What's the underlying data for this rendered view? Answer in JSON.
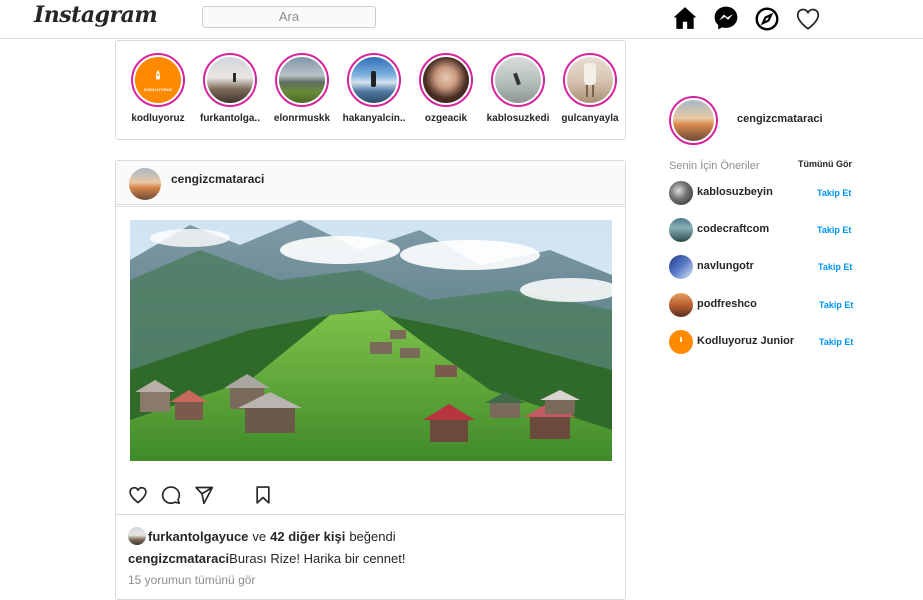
{
  "header": {
    "logo": "Instagram",
    "search_placeholder": "Ara",
    "icons": [
      "home-icon",
      "messenger-icon",
      "explore-icon",
      "heart-icon"
    ]
  },
  "stories": [
    {
      "name": "kodluyoruz",
      "logo_text": "KODLUYORUZ"
    },
    {
      "name": "furkantolga.."
    },
    {
      "name": "elonrmuskk"
    },
    {
      "name": "hakanyalcin.."
    },
    {
      "name": "ozgeacik"
    },
    {
      "name": "kablosuzkedi"
    },
    {
      "name": "gulcanyayla"
    }
  ],
  "post": {
    "username": "cengizcmataraci",
    "liked_by": "furkantolgayuce",
    "and_text": "ve",
    "others": "42 diğer kişi",
    "liked_text": "beğendi",
    "caption_user": "cengizcmataraci",
    "caption_text": "Burası Rize! Harika bir cennet!",
    "comments_link": "15 yorumun tümünü gör",
    "action_icons": [
      "heart-icon",
      "comment-icon",
      "share-icon",
      "bookmark-icon"
    ]
  },
  "sidebar": {
    "username": "cengizcmataraci",
    "suggestions_title": "Senin İçin Öneriler",
    "see_all": "Tümünü Gör",
    "suggestions": [
      {
        "name": "kablosuzbeyin",
        "follow": "Takip Et"
      },
      {
        "name": "codecraftcom",
        "follow": "Takip Et"
      },
      {
        "name": "navlungotr",
        "follow": "Takip Et"
      },
      {
        "name": "podfreshco",
        "follow": "Takip Et"
      },
      {
        "name": "Kodluyoruz Junior",
        "follow": "Takip Et"
      }
    ]
  },
  "colors": {
    "story_ring": "#d6249f",
    "link_blue": "#0095f6",
    "border": "#dbdbdb",
    "muted": "#8e8e8e",
    "kodluyoruz_orange": "#ff8a00"
  }
}
